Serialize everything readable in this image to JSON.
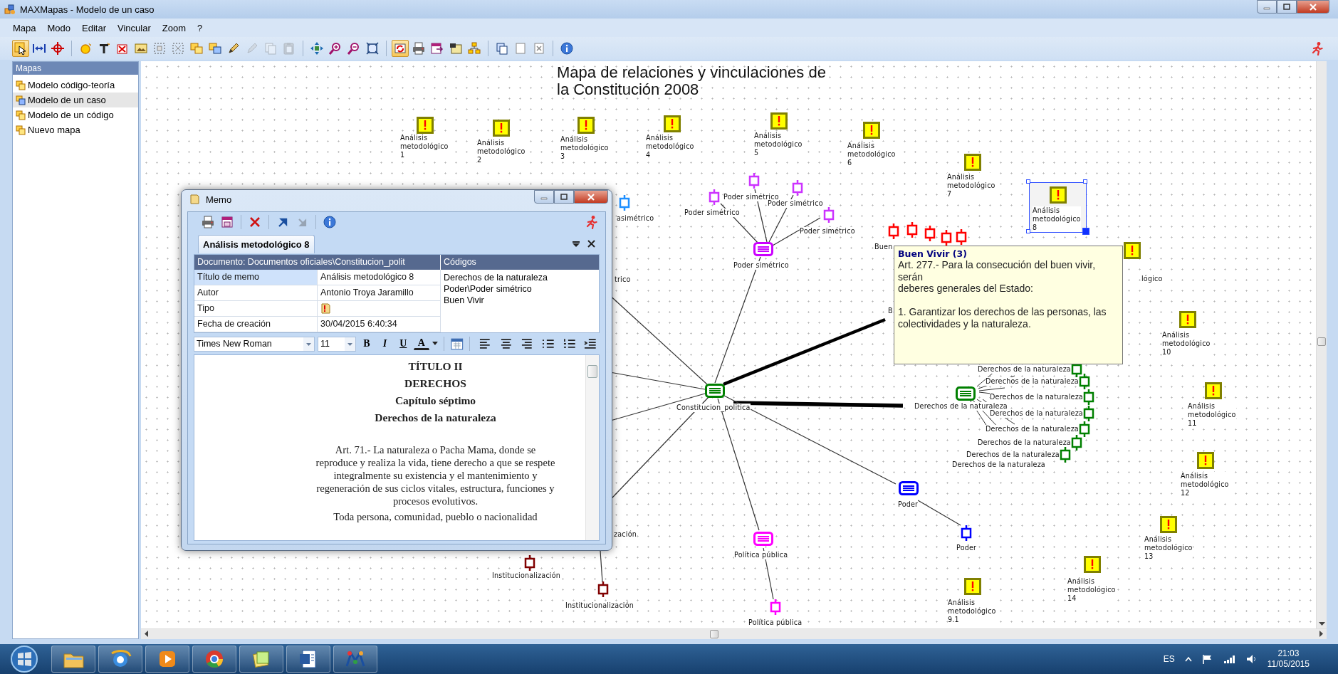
{
  "window": {
    "title": "MAXMapas - Modelo de un caso"
  },
  "menu": [
    "Mapa",
    "Modo",
    "Editar",
    "Vincular",
    "Zoom",
    "?"
  ],
  "toolbar": {
    "groups": [
      [
        {
          "pressed": true,
          "disabled": false
        },
        {
          "pressed": false,
          "disabled": false
        },
        {
          "pressed": false,
          "disabled": false
        }
      ],
      [
        {
          "pressed": false,
          "disabled": false
        },
        {
          "pressed": false,
          "disabled": false
        },
        {
          "pressed": false,
          "disabled": false
        },
        {
          "pressed": false,
          "disabled": false
        },
        {
          "pressed": false,
          "disabled": false
        },
        {
          "pressed": false,
          "disabled": false
        },
        {
          "pressed": false,
          "disabled": false
        },
        {
          "pressed": false,
          "disabled": false
        },
        {
          "pressed": false,
          "disabled": false
        },
        {
          "pressed": false,
          "disabled": true
        },
        {
          "pressed": false,
          "disabled": true
        },
        {
          "pressed": false,
          "disabled": true
        }
      ],
      [
        {
          "pressed": false,
          "disabled": false
        },
        {
          "pressed": false,
          "disabled": false
        },
        {
          "pressed": false,
          "disabled": false
        },
        {
          "pressed": false,
          "disabled": false
        }
      ],
      [
        {
          "pressed": true,
          "disabled": false
        },
        {
          "pressed": false,
          "disabled": false
        },
        {
          "pressed": false,
          "disabled": false
        },
        {
          "pressed": false,
          "disabled": false
        },
        {
          "pressed": false,
          "disabled": false
        }
      ],
      [
        {
          "pressed": false,
          "disabled": false
        },
        {
          "pressed": false,
          "disabled": false
        },
        {
          "pressed": false,
          "disabled": false
        }
      ],
      [
        {
          "pressed": false,
          "disabled": false
        }
      ]
    ]
  },
  "sidebar": {
    "title": "Mapas",
    "items": [
      {
        "label": "Modelo código-teoría",
        "selected": false
      },
      {
        "label": "Modelo de un caso",
        "selected": true
      },
      {
        "label": "Modelo de un código",
        "selected": false
      },
      {
        "label": "Nuevo mapa",
        "selected": false
      }
    ]
  },
  "map": {
    "title_lines": [
      "Mapa de relaciones y vinculaciones de",
      "la Constitución 2008"
    ],
    "nodes": [
      {
        "kind": "memo",
        "label": "Análisis metodológico 1",
        "selected": false
      },
      {
        "kind": "memo",
        "label": "Análisis metodológico 2",
        "selected": false
      },
      {
        "kind": "memo",
        "label": "Análisis metodológico 3",
        "selected": false
      },
      {
        "kind": "memo",
        "label": "Análisis metodológico 4",
        "selected": false
      },
      {
        "kind": "memo",
        "label": "Análisis metodológico 5",
        "selected": false
      },
      {
        "kind": "memo",
        "label": "Análisis metodológico 6",
        "selected": false
      },
      {
        "kind": "memo",
        "label": "Análisis metodológico 7",
        "selected": false
      },
      {
        "kind": "code",
        "label": "asimétrico",
        "color": "#1e8fff",
        "selected": false
      },
      {
        "kind": "code",
        "label": "Poder simétrico",
        "color": "#cc33ff",
        "selected": false
      },
      {
        "kind": "code",
        "label": "Poder simétrico",
        "color": "#cc33ff",
        "selected": false
      },
      {
        "kind": "code",
        "label": "Poder simétrico",
        "color": "#cc33ff",
        "selected": false
      },
      {
        "kind": "code",
        "label": "Poder simétrico",
        "color": "#cc33ff",
        "selected": false
      },
      {
        "kind": "document",
        "label": "Poder simétrico",
        "color": "#cc00ff",
        "selected": false
      },
      {
        "kind": "code",
        "label": "Buen",
        "color": "#ff0000",
        "selected": false
      },
      {
        "kind": "code",
        "color": "#ff0000",
        "selected": false
      },
      {
        "kind": "code",
        "color": "#ff0000",
        "selected": false
      },
      {
        "kind": "code",
        "color": "#ff0000",
        "selected": false
      },
      {
        "kind": "code",
        "color": "#ff0000",
        "selected": false
      },
      {
        "kind": "memo",
        "label": "Análisis metodológico 8",
        "selected": true
      },
      {
        "kind": "memo",
        "label": "lógico",
        "selected": false
      },
      {
        "kind": "label",
        "label": "trico",
        "selected": false
      },
      {
        "kind": "label",
        "label": "B",
        "selected": false
      },
      {
        "kind": "memo",
        "label": "Análisis metodológico 10",
        "selected": false
      },
      {
        "kind": "document",
        "label": "Constitucion_politica",
        "color": "#008000",
        "selected": false
      },
      {
        "kind": "document",
        "label": "Derechos de la naturaleza",
        "color": "#008000",
        "selected": false
      },
      {
        "kind": "code",
        "label": "Derechos de la naturaleza",
        "color": "#008000",
        "selected": false
      },
      {
        "kind": "code",
        "label": "Derechos de la naturaleza",
        "color": "#008000",
        "selected": false
      },
      {
        "kind": "code",
        "label": "Derechos de la naturaleza",
        "color": "#008000",
        "selected": false
      },
      {
        "kind": "code",
        "label": "Derechos de la naturaleza",
        "color": "#008000",
        "selected": false
      },
      {
        "kind": "code",
        "label": "Derechos de la naturaleza",
        "color": "#008000",
        "selected": false
      },
      {
        "kind": "code",
        "label": "Derechos de la naturaleza",
        "color": "#008000",
        "selected": false
      },
      {
        "kind": "code",
        "label": "Derechos de la naturaleza",
        "color": "#008000",
        "selected": false
      },
      {
        "kind": "label",
        "label": "Derechos de la naturaleza",
        "selected": false
      },
      {
        "kind": "memo",
        "label": "Análisis metodológico 11",
        "selected": false
      },
      {
        "kind": "document",
        "label": "Poder",
        "color": "#0000ff",
        "selected": false
      },
      {
        "kind": "memo",
        "label": "Análisis metodológico 12",
        "selected": false
      },
      {
        "kind": "label",
        "label": "zación",
        "selected": false
      },
      {
        "kind": "code",
        "label": "Institucionalización",
        "color": "#800000",
        "selected": false
      },
      {
        "kind": "document",
        "label": "Política pública",
        "color": "#ff00ff",
        "selected": false
      },
      {
        "kind": "code",
        "label": "Poder",
        "color": "#0000ff",
        "selected": false
      },
      {
        "kind": "memo",
        "label": "Análisis metodológico 13",
        "selected": false
      },
      {
        "kind": "code",
        "label": "Institucionalización",
        "color": "#800000",
        "selected": false
      },
      {
        "kind": "code",
        "label": "Política pública",
        "color": "#ff00ff",
        "selected": false
      },
      {
        "kind": "memo",
        "label": "Análisis metodológico 9.1",
        "selected": false
      },
      {
        "kind": "memo",
        "label": "Análisis metodológico 14",
        "selected": false
      }
    ]
  },
  "tooltip": {
    "title": "Buen Vivir (3)",
    "paragraphs": [
      [
        "Art. 277.- Para la consecución del buen vivir,",
        "serán",
        "deberes generales del Estado:"
      ],
      [
        "1. Garantizar los derechos de las personas, las",
        "colectividades y la naturaleza."
      ]
    ]
  },
  "memo": {
    "title": "Memo",
    "toolbar": [
      {
        "disabled": false
      },
      {
        "disabled": false
      },
      {
        "disabled": false
      },
      {
        "disabled": false
      },
      {
        "disabled": true
      },
      {
        "disabled": false
      }
    ],
    "tab": {
      "label": "Análisis metodológico 8",
      "selected": true
    },
    "header": [
      "Documento: Documentos oficiales\\Constitucion_polit",
      "Códigos"
    ],
    "properties": [
      {
        "kind": "text",
        "label": "Título de memo",
        "value": "Análisis metodológico 8",
        "selected": true
      },
      {
        "kind": "text",
        "label": "Autor",
        "value": "Antonio Troya Jaramillo",
        "selected": false
      },
      {
        "kind": "icon",
        "label": "Tipo",
        "selected": false
      },
      {
        "kind": "text",
        "label": "Fecha de creación",
        "value": "30/04/2015 6:40:34",
        "selected": false
      }
    ],
    "codes": [
      "Derechos de la naturaleza",
      "Poder\\Poder simétrico",
      "Buen Vivir"
    ],
    "font": "Times New Roman",
    "size": "11",
    "format_buttons": [
      "B",
      "I",
      "U",
      "A"
    ],
    "content": [
      {
        "kind": "heading",
        "lines": [
          "TÍTULO II"
        ]
      },
      {
        "kind": "heading",
        "lines": [
          "DERECHOS"
        ]
      },
      {
        "kind": "heading",
        "lines": [
          "Capítulo séptimo"
        ]
      },
      {
        "kind": "heading",
        "lines": [
          "Derechos de la naturaleza"
        ]
      },
      {
        "kind": "paragraph",
        "lines": [
          "Art. 71.- La naturaleza o Pacha Mama, donde se",
          "reproduce y realiza la vida, tiene derecho a que se respete",
          "integralmente su existencia y el mantenimiento y",
          "regeneración de sus ciclos vitales, estructura, funciones y",
          "procesos evolutivos."
        ]
      },
      {
        "kind": "paragraph",
        "lines": [
          "Toda persona, comunidad, pueblo o nacionalidad"
        ]
      }
    ]
  },
  "taskbar": {
    "language": "ES",
    "time": "21:03",
    "date": "11/05/2015"
  }
}
